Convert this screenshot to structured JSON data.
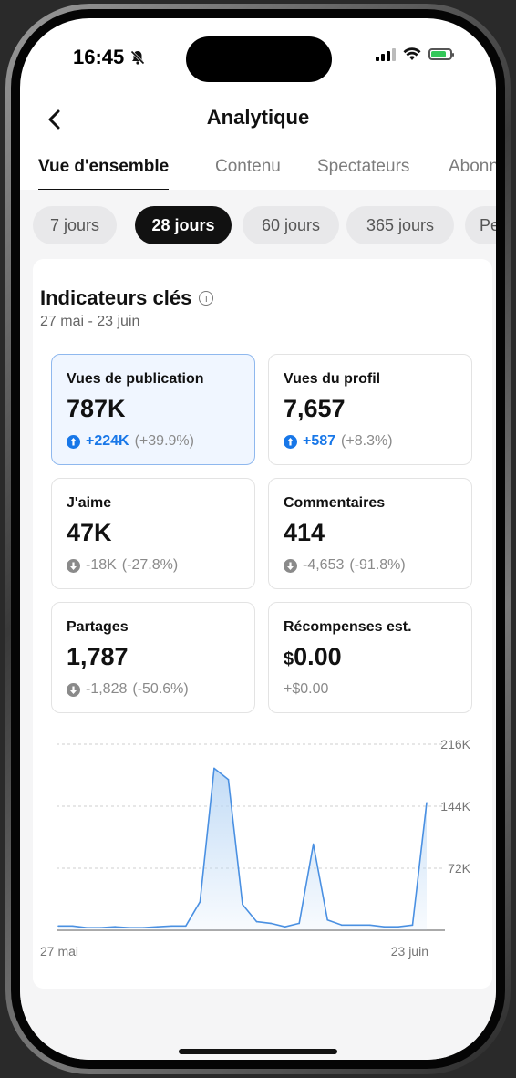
{
  "status_bar": {
    "time": "16:45"
  },
  "header": {
    "title": "Analytique"
  },
  "tabs": [
    {
      "label": "Vue d'ensemble",
      "active": true
    },
    {
      "label": "Contenu",
      "active": false
    },
    {
      "label": "Spectateurs",
      "active": false
    },
    {
      "label": "Abonn",
      "active": false
    }
  ],
  "periods": [
    {
      "label": "7 jours",
      "active": false
    },
    {
      "label": "28 jours",
      "active": true
    },
    {
      "label": "60 jours",
      "active": false
    },
    {
      "label": "365 jours",
      "active": false
    },
    {
      "label": "Pe",
      "active": false
    }
  ],
  "key_metrics": {
    "title": "Indicateurs clés",
    "date_range": "27 mai - 23 juin",
    "items": [
      {
        "label": "Vues de publication",
        "value": "787K",
        "delta": "+224K",
        "pct": "(+39.9%)",
        "trend": "up",
        "selected": true
      },
      {
        "label": "Vues du profil",
        "value": "7,657",
        "delta": "+587",
        "pct": "(+8.3%)",
        "trend": "up",
        "selected": false
      },
      {
        "label": "J'aime",
        "value": "47K",
        "delta": "-18K",
        "pct": "(-27.8%)",
        "trend": "down",
        "selected": false
      },
      {
        "label": "Commentaires",
        "value": "414",
        "delta": "-4,653",
        "pct": "(-91.8%)",
        "trend": "down",
        "selected": false
      },
      {
        "label": "Partages",
        "value": "1,787",
        "delta": "-1,828",
        "pct": "(-50.6%)",
        "trend": "down",
        "selected": false
      },
      {
        "label": "Récompenses est.",
        "value_prefix": "$",
        "value": "0.00",
        "delta": "+$0.00",
        "pct": "",
        "trend": "flat",
        "selected": false
      }
    ]
  },
  "chart_data": {
    "type": "area",
    "x_labels": [
      "27 mai",
      "23 juin"
    ],
    "y_ticks": [
      "216K",
      "144K",
      "72K"
    ],
    "ylim": [
      0,
      216000
    ],
    "grid": true,
    "colors": {
      "line": "#4a90e2",
      "fill_top": "#bcd8f5"
    },
    "series": [
      {
        "values": [
          5000,
          5000,
          3000,
          3000,
          4000,
          3000,
          3000,
          4000,
          5000,
          5000,
          33000,
          188000,
          175000,
          30000,
          10000,
          8000,
          4000,
          8000,
          100000,
          12000,
          6000,
          6000,
          6000,
          4000,
          4000,
          6000,
          148000
        ]
      }
    ]
  },
  "colors": {
    "accent": "#1877e8",
    "active_chip": "#111111"
  }
}
